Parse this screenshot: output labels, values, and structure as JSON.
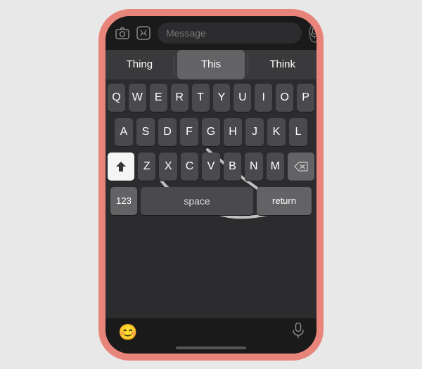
{
  "phone": {
    "top_bar": {
      "camera_icon": "📷",
      "appstore_icon": "🅐",
      "message_placeholder": "Message",
      "mic_icon": "🎙"
    },
    "predictive": {
      "left": "Thing",
      "center": "This",
      "right": "Think"
    },
    "keyboard": {
      "row1": [
        "Q",
        "W",
        "E",
        "R",
        "T",
        "Y",
        "U",
        "I",
        "O",
        "P"
      ],
      "row2": [
        "A",
        "S",
        "D",
        "F",
        "G",
        "H",
        "J",
        "K",
        "L"
      ],
      "row3": [
        "Z",
        "X",
        "C",
        "V",
        "B",
        "N",
        "M"
      ],
      "shift_label": "↑",
      "delete_label": "⌫",
      "numbers_label": "123",
      "space_label": "space",
      "return_label": "return"
    },
    "bottom": {
      "emoji_icon": "😊",
      "mic_icon": "🎙"
    }
  }
}
